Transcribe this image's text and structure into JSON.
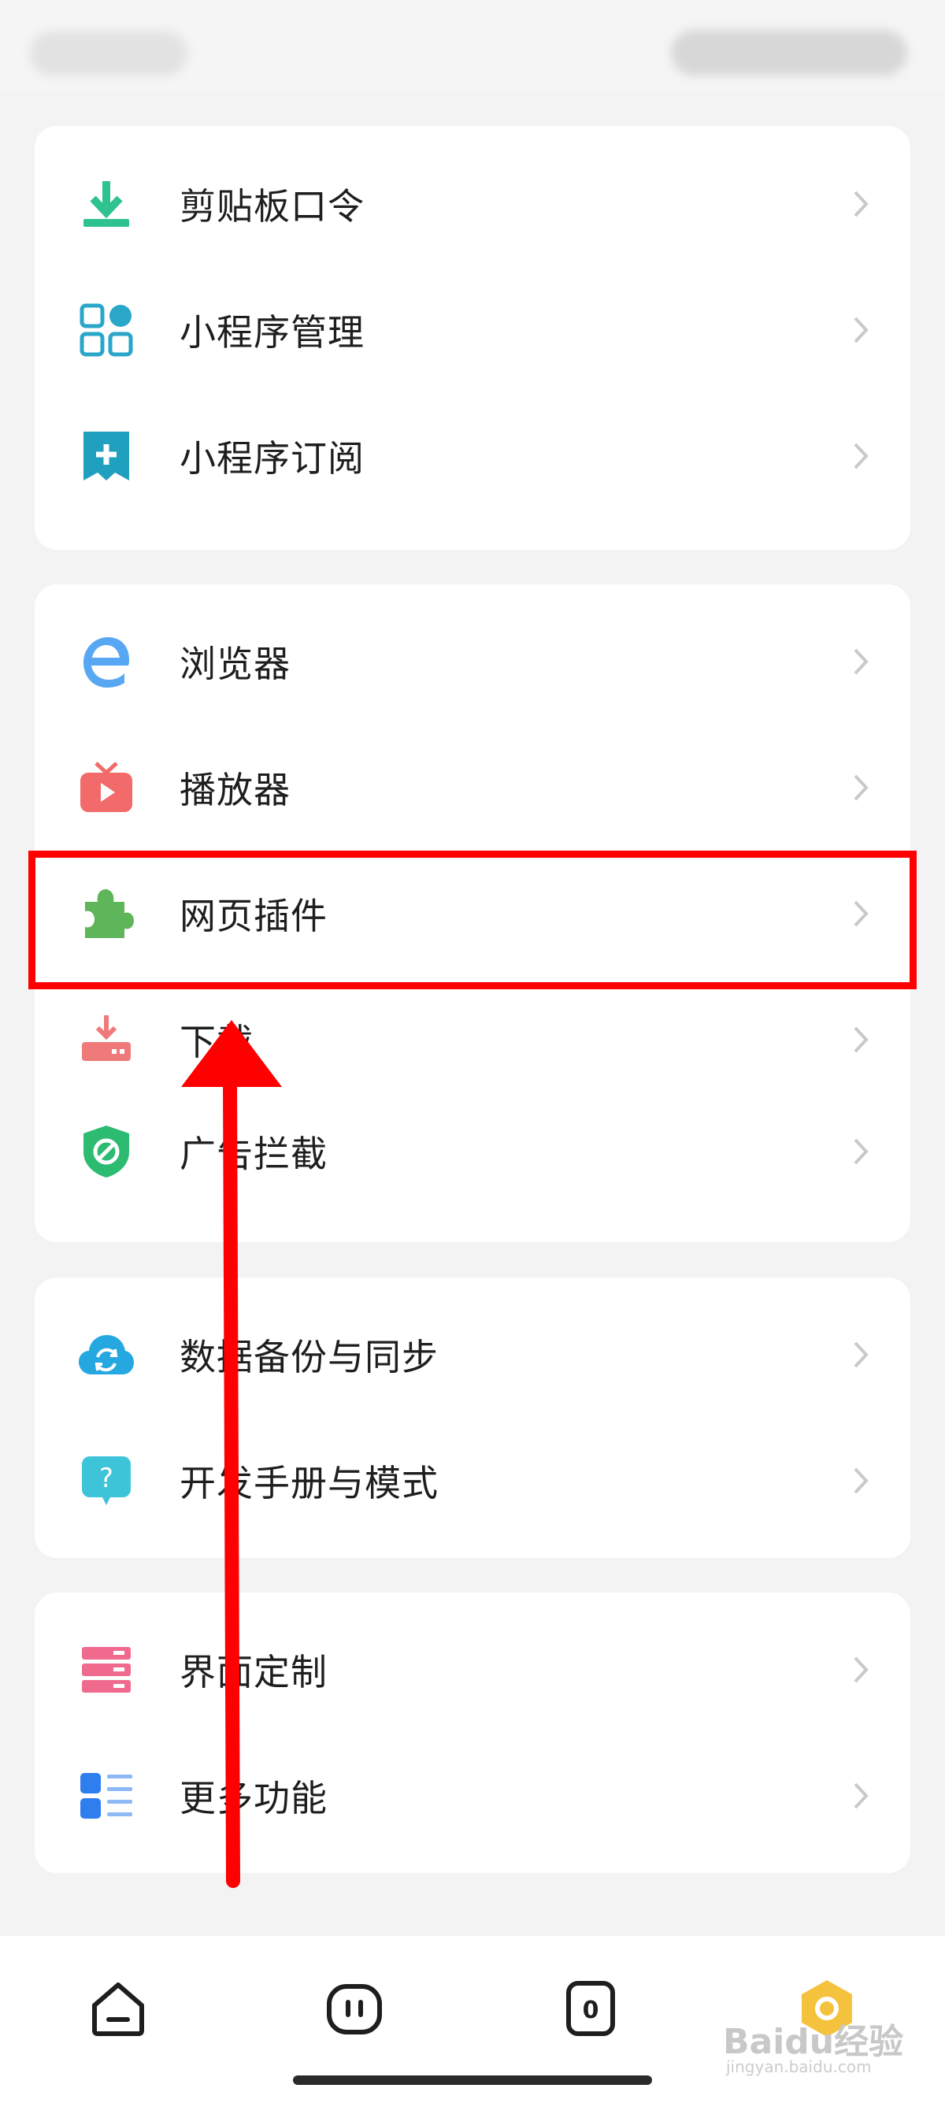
{
  "groups": [
    {
      "items": [
        {
          "label": "剪贴板口令",
          "icon": "clipboard-download-icon"
        },
        {
          "label": "小程序管理",
          "icon": "grid-apps-icon"
        },
        {
          "label": "小程序订阅",
          "icon": "bookmark-plus-icon"
        }
      ]
    },
    {
      "items": [
        {
          "label": "浏览器",
          "icon": "browser-e-icon"
        },
        {
          "label": "播放器",
          "icon": "tv-play-icon"
        },
        {
          "label": "网页插件",
          "icon": "puzzle-icon"
        },
        {
          "label": "下载",
          "icon": "download-tray-icon"
        },
        {
          "label": "广告拦截",
          "icon": "shield-block-icon"
        }
      ]
    },
    {
      "items": [
        {
          "label": "数据备份与同步",
          "icon": "cloud-sync-icon"
        },
        {
          "label": "开发手册与模式",
          "icon": "help-bubble-icon"
        }
      ]
    },
    {
      "items": [
        {
          "label": "界面定制",
          "icon": "layout-custom-icon"
        },
        {
          "label": "更多功能",
          "icon": "more-list-icon"
        }
      ]
    }
  ],
  "bottom_nav": [
    {
      "icon": "home-icon"
    },
    {
      "icon": "pause-face-icon"
    },
    {
      "icon": "tab-count-icon",
      "count": "0"
    },
    {
      "icon": "profile-hex-icon"
    }
  ],
  "watermark": {
    "text": "Baidu经验",
    "sub": "jingyan.baidu.com"
  },
  "colors": {
    "background": "#f3f3f3",
    "card": "#ffffff",
    "highlight": "#ff0000",
    "arrow": "#ff0000"
  }
}
